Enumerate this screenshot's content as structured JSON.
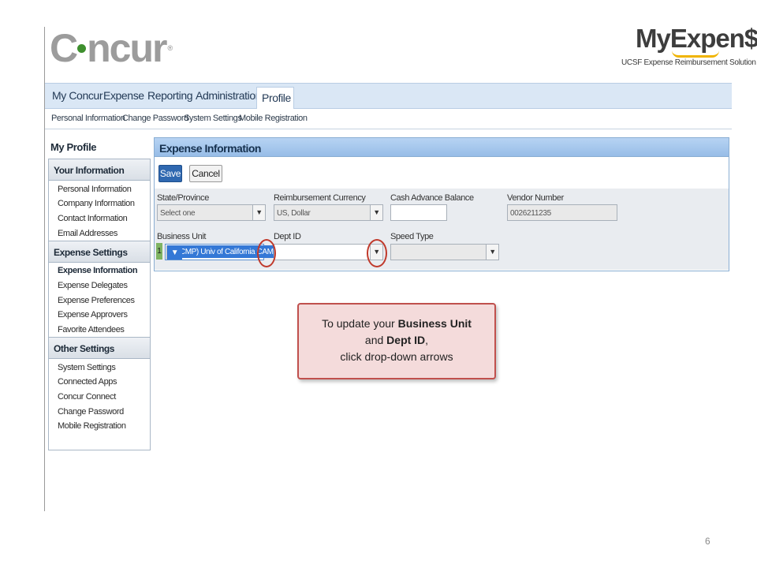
{
  "header": {
    "concur_logo": "Concur",
    "myexpense_logo": "MyExpen$e",
    "myexpense_tagline": "UCSF Expense Reimbursement Solution"
  },
  "nav": {
    "tabs": [
      {
        "label": "My Concur"
      },
      {
        "label": "Expense"
      },
      {
        "label": "Reporting"
      },
      {
        "label": "Administration"
      },
      {
        "label": "Profile"
      }
    ],
    "subtabs": [
      {
        "label": "Personal Information"
      },
      {
        "label": "Change Password"
      },
      {
        "label": "System Settings"
      },
      {
        "label": "Mobile Registration"
      }
    ]
  },
  "sidebar": {
    "title": "My Profile",
    "sections": [
      {
        "heading": "Your Information",
        "items": [
          "Personal Information",
          "Company Information",
          "Contact Information",
          "Email Addresses"
        ]
      },
      {
        "heading": "Expense Settings",
        "items": [
          "Expense Information",
          "Expense Delegates",
          "Expense Preferences",
          "Expense Approvers",
          "Favorite Attendees"
        ]
      },
      {
        "heading": "Other Settings",
        "items": [
          "System Settings",
          "Connected Apps",
          "Concur Connect",
          "Change Password",
          "Mobile Registration"
        ]
      }
    ]
  },
  "panel": {
    "title": "Expense Information",
    "save_label": "Save",
    "cancel_label": "Cancel",
    "fields": {
      "state_label": "State/Province",
      "state_value": "Select one",
      "currency_label": "Reimbursement Currency",
      "currency_value": "US, Dollar",
      "cash_label": "Cash Advance Balance",
      "cash_value": "",
      "vendor_label": "Vendor Number",
      "vendor_value": "0026211235",
      "bu_label": "Business Unit",
      "bu_index": "1",
      "bu_value": "(SFCMP) Univ of California CAMPUS",
      "dept_label": "Dept ID",
      "dept_value": "",
      "speed_label": "Speed Type",
      "speed_value": ""
    }
  },
  "callout": {
    "text1": "To update your ",
    "bold1": "Business Unit",
    "text2": "and ",
    "bold2": "Dept ID",
    "text3": ",",
    "line3": "click drop-down arrows"
  },
  "page_number": "6",
  "colors": {
    "accent": "#2f68b0",
    "highlight": "#c0392b",
    "nav_bg": "#dae7f5"
  }
}
